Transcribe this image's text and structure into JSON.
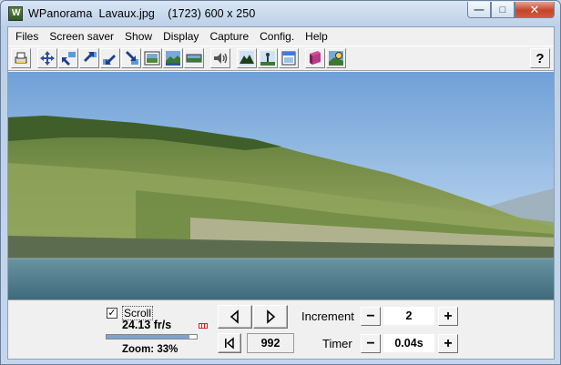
{
  "window": {
    "title": "WPanorama  Lavaux.jpg    (1723) 600 x 250",
    "minimize_glyph": "—",
    "maximize_glyph": "□",
    "close_glyph": "✕"
  },
  "menu": [
    "Files",
    "Screen saver",
    "Show",
    "Display",
    "Capture",
    "Config.",
    "Help"
  ],
  "toolbar": {
    "icons": [
      "print-icon",
      "move-all-icon",
      "arrow-up-left-icon",
      "arrow-up-right-icon",
      "arrow-down-left-icon",
      "arrow-down-right-icon",
      "picture-frame-icon",
      "landscape-tall-icon",
      "landscape-wide-icon",
      "speaker-icon",
      "mountain-icon",
      "figure-icon",
      "calendar-icon",
      "book-icon",
      "landscape-help-icon"
    ],
    "help_label": "?"
  },
  "controls": {
    "scroll_label": "Scroll",
    "scroll_checked_glyph": "✓",
    "fps": "24.13 fr/s",
    "zoom_label": "Zoom: 33%",
    "zoom_fraction": 0.33,
    "position_value": "992",
    "increment_label": "Increment",
    "increment_value": "2",
    "timer_label": "Timer",
    "timer_value": "0.04s",
    "minus_glyph": "−",
    "plus_glyph": "+"
  },
  "colors": {
    "sky_top": "#6fa0d8",
    "sky_bottom": "#d6e8f5",
    "lake": "#4f7c8f",
    "hillside": "#7d9a4e",
    "zoom_fill": "#7da2cf"
  }
}
